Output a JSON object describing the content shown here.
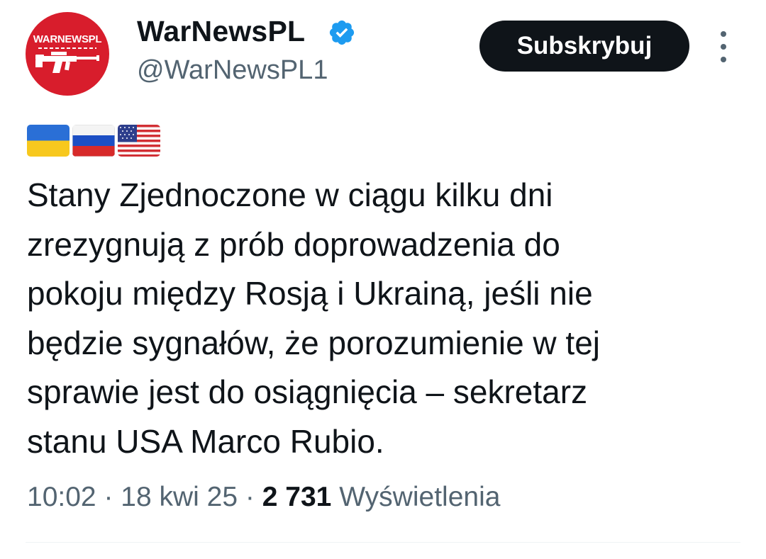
{
  "account": {
    "display_name": "WarNewsPL",
    "handle": "@WarNewsPL1",
    "verified": true,
    "avatar_text": "WARNEWSPL",
    "avatar_color": "#d81d2c"
  },
  "actions": {
    "subscribe_label": "Subskrybuj",
    "more_icon": "more-vertical-icon"
  },
  "tweet": {
    "flags": [
      "ukraine-flag",
      "russia-flag",
      "usa-flag"
    ],
    "text": "Stany Zjednoczone w ciągu kilku dni\nzrezygnują z prób doprowadzenia do\npokoju między Rosją i Ukrainą, jeśli nie\nbędzie sygnałów, że porozumienie w tej\nsprawie jest do osiągnięcia – sekretarz\nstanu USA Marco Rubio.",
    "time": "10:02",
    "date": "18 kwi 25",
    "views_count": "2 731",
    "views_label": "Wyświetlenia",
    "separator": "·"
  },
  "colors": {
    "text": "#0f1419",
    "secondary": "#536471",
    "verified": "#1d9bf0",
    "button_bg": "#0f1419"
  }
}
